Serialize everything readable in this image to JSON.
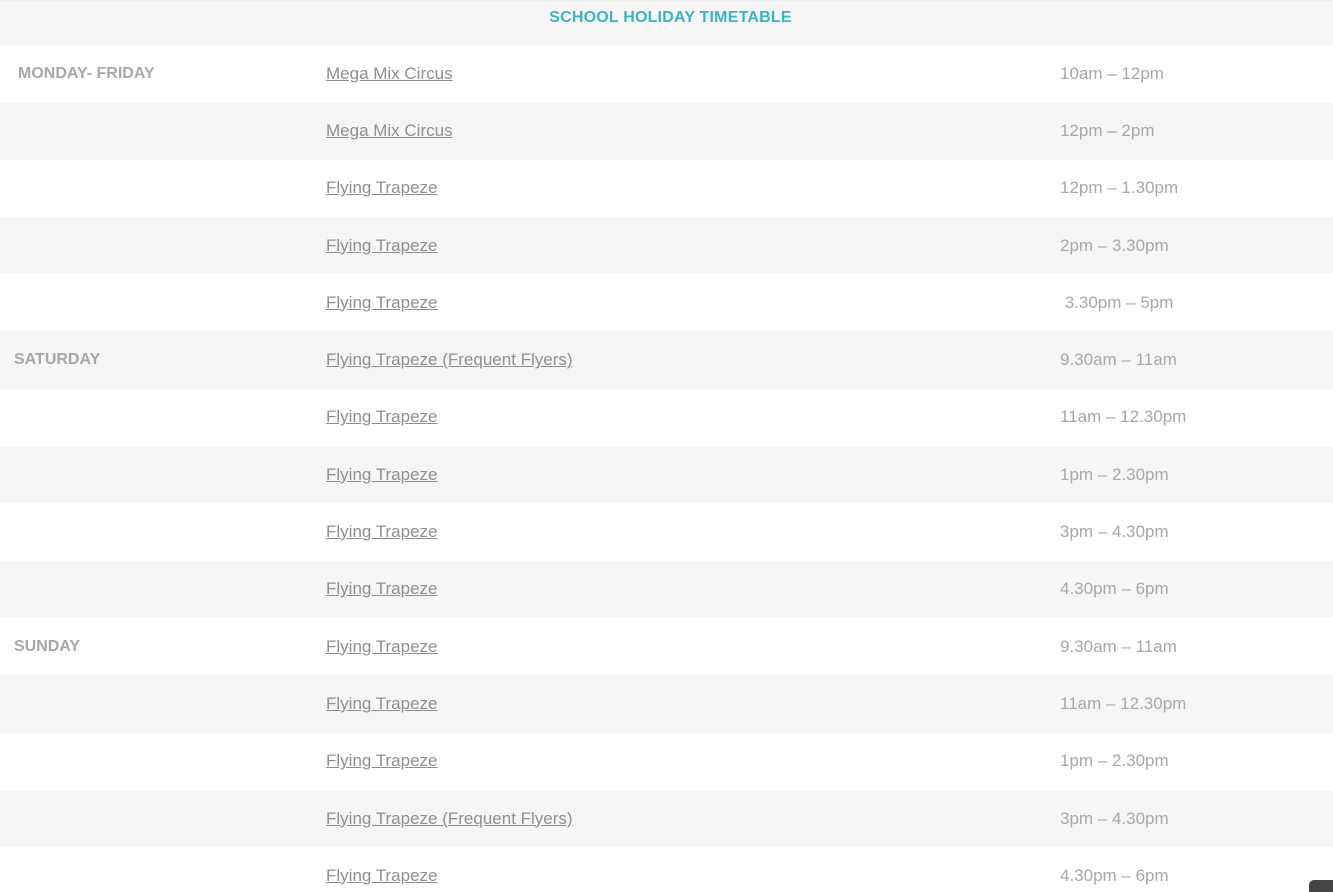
{
  "title": "SCHOOL HOLIDAY TIMETABLE",
  "colors": {
    "title": "#3bb3c0",
    "text": "#a7a7a7",
    "link": "#8f8f8f",
    "row_alt": "#f6f6f6"
  },
  "rows": [
    {
      "day": "MONDAY- FRIDAY",
      "class": "Mega Mix Circus",
      "time": "10am – 12pm"
    },
    {
      "day": "",
      "class": "Mega Mix Circus",
      "time": "12pm – 2pm"
    },
    {
      "day": "",
      "class": "Flying Trapeze",
      "time": "12pm – 1.30pm"
    },
    {
      "day": "",
      "class": "Flying Trapeze",
      "time": "2pm – 3.30pm"
    },
    {
      "day": "",
      "class": "Flying Trapeze",
      "time": " 3.30pm – 5pm"
    },
    {
      "day": "SATURDAY",
      "class": "Flying Trapeze (Frequent Flyers)",
      "time": "9.30am – 11am"
    },
    {
      "day": "",
      "class": "Flying Trapeze",
      "time": "11am – 12.30pm"
    },
    {
      "day": "",
      "class": "Flying Trapeze",
      "time": "1pm – 2.30pm"
    },
    {
      "day": "",
      "class": "Flying Trapeze",
      "time": "3pm – 4.30pm"
    },
    {
      "day": "",
      "class": "Flying Trapeze",
      "time": "4.30pm – 6pm"
    },
    {
      "day": "SUNDAY",
      "class": "Flying Trapeze",
      "time": "9.30am – 11am"
    },
    {
      "day": "",
      "class": "Flying Trapeze",
      "time": "11am – 12.30pm"
    },
    {
      "day": "",
      "class": "Flying Trapeze",
      "time": "1pm – 2.30pm"
    },
    {
      "day": "",
      "class": "Flying Trapeze (Frequent Flyers)",
      "time": "3pm – 4.30pm"
    },
    {
      "day": "",
      "class": "Flying Trapeze",
      "time": "4.30pm – 6pm"
    }
  ]
}
